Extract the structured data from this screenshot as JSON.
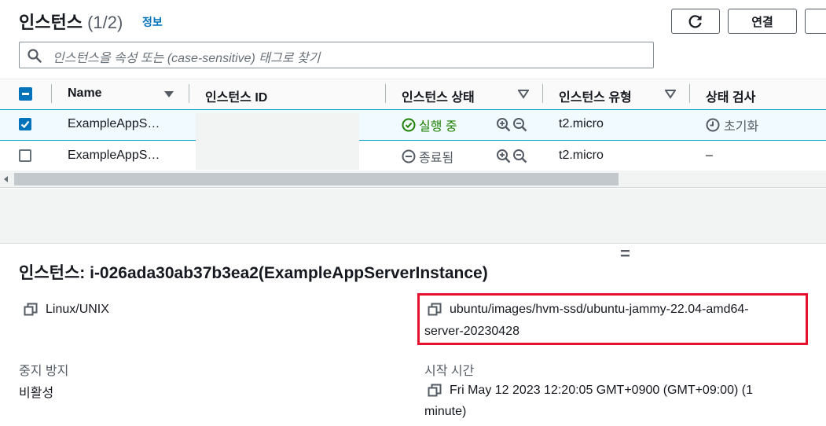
{
  "header": {
    "title": "인스턴스",
    "count": "(1/2)",
    "info_link": "정보",
    "connect_button": "연결"
  },
  "search": {
    "placeholder": "인스턴스을 속성 또는 (case-sensitive) 태그로 찾기"
  },
  "table": {
    "columns": [
      "Name",
      "인스턴스 ID",
      "인스턴스 상태",
      "인스턴스 유형",
      "상태 검사"
    ],
    "rows": [
      {
        "selected": true,
        "name": "ExampleAppS…",
        "instance_id": "",
        "state": "실행 중",
        "type": "t2.micro",
        "check": "초기화"
      },
      {
        "selected": false,
        "name": "ExampleAppS…",
        "instance_id": "",
        "state": "종료됨",
        "type": "t2.micro",
        "check": "–"
      }
    ]
  },
  "resize_handle": "=",
  "details": {
    "title": "인스턴스: i-026ada30ab37b3ea2(ExampleAppServerInstance)",
    "platform": "Linux/UNIX",
    "ami_line1": "ubuntu/images/hvm-ssd/ubuntu-jammy-22.04-amd64-",
    "ami_line2": "server-20230428",
    "stop_protection_label": "중지 방지",
    "stop_protection_value": "비활성",
    "launch_time_label": "시작 시간",
    "launch_time_line1": "Fri May 12 2023 12:20:05 GMT+0900 (GMT+09:00) (1",
    "launch_time_line2": "minute)"
  },
  "colors": {
    "accent": "#0073bb",
    "running": "#1d8102",
    "highlight": "#e8112d"
  }
}
